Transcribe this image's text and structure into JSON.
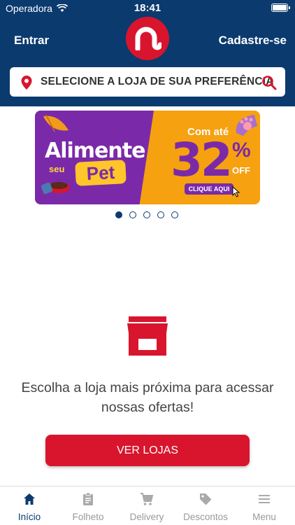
{
  "status_bar": {
    "carrier": "Operadora",
    "time": "18:41"
  },
  "header": {
    "login_label": "Entrar",
    "signup_label": "Cadastre-se",
    "store_selector_text": "SELECIONE A LOJA DE SUA PREFERÊNCIA"
  },
  "banner": {
    "headline": "Alimente",
    "seu": "seu",
    "pet": "Pet",
    "com_ate": "Com até",
    "discount_number": "32",
    "percent": "%",
    "off": "OFF",
    "cta": "CLIQUE AQUI",
    "slides_total": 5,
    "active_slide": 1
  },
  "empty_state": {
    "message": "Escolha a loja mais próxima para acessar nossas ofertas!",
    "button_label": "VER LOJAS"
  },
  "tabbar": {
    "items": [
      {
        "label": "Início",
        "icon": "home-icon",
        "active": true
      },
      {
        "label": "Folheto",
        "icon": "clipboard-icon",
        "active": false
      },
      {
        "label": "Delivery",
        "icon": "cart-icon",
        "active": false
      },
      {
        "label": "Descontos",
        "icon": "tag-icon",
        "active": false
      },
      {
        "label": "Menu",
        "icon": "menu-icon",
        "active": false
      }
    ]
  },
  "colors": {
    "brand_blue": "#0b3a6f",
    "brand_red": "#d8152d",
    "banner_purple": "#7a2aa8",
    "banner_orange": "#f6a10f"
  }
}
